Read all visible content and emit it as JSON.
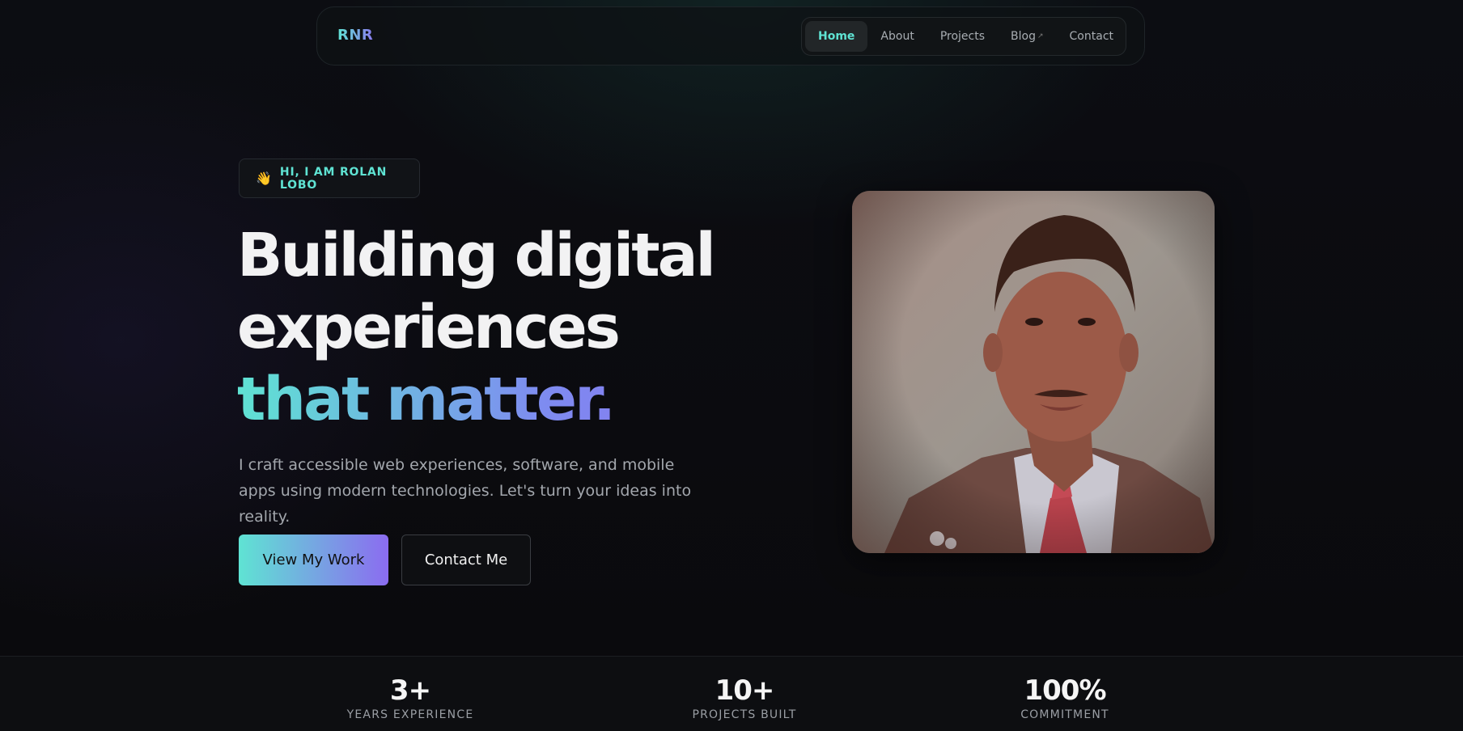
{
  "nav": {
    "brand": "RNR",
    "items": [
      {
        "label": "Home",
        "active": true,
        "external": false
      },
      {
        "label": "About",
        "active": false,
        "external": false
      },
      {
        "label": "Projects",
        "active": false,
        "external": false
      },
      {
        "label": "Blog",
        "active": false,
        "external": true
      },
      {
        "label": "Contact",
        "active": false,
        "external": false
      }
    ]
  },
  "hero": {
    "greeting": "HI, I AM ROLAN LOBO",
    "greeting_icon": "👋",
    "headline_line1": "Building digital",
    "headline_line2": "experiences",
    "headline_highlight": "that matter.",
    "subtext": "I craft accessible web experiences, software, and mobile apps using modern technologies. Let's turn your ideas into reality.",
    "primary_button": "View My Work",
    "secondary_button": "Contact Me"
  },
  "stats": [
    {
      "value": "3+",
      "label": "YEARS EXPERIENCE"
    },
    {
      "value": "10+",
      "label": "PROJECTS BUILT"
    },
    {
      "value": "100%",
      "label": "COMMITMENT"
    }
  ],
  "colors": {
    "accent_teal": "#5fe3d3",
    "accent_purple": "#8b6cf0",
    "background": "#0b0b0f"
  }
}
